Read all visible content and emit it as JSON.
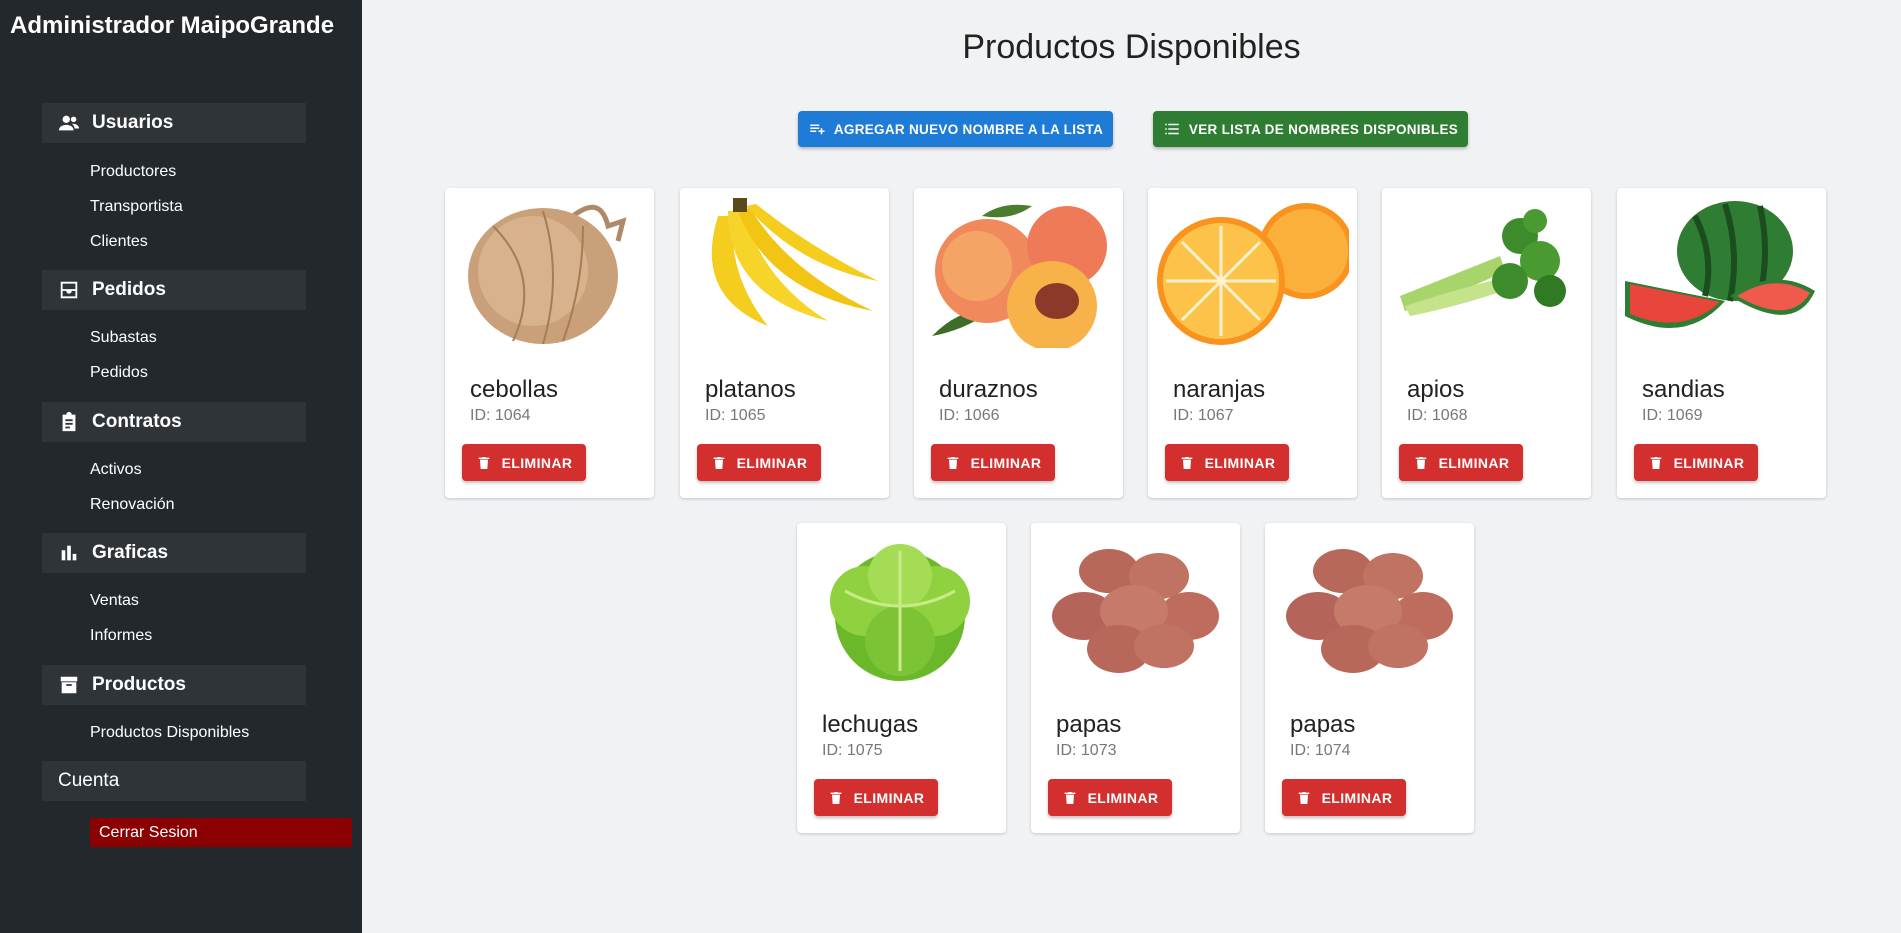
{
  "sidebar": {
    "brand": "Administrador MaipoGrande",
    "sections": [
      {
        "title": "Usuarios",
        "icon": "users-icon",
        "items": [
          "Productores",
          "Transportista",
          "Clientes"
        ]
      },
      {
        "title": "Pedidos",
        "icon": "inbox-icon",
        "items": [
          "Subastas",
          "Pedidos"
        ]
      },
      {
        "title": "Contratos",
        "icon": "clipboard-icon",
        "items": [
          "Activos",
          "Renovación"
        ]
      },
      {
        "title": "Graficas",
        "icon": "bar-chart-icon",
        "items": [
          "Ventas",
          "Informes"
        ]
      },
      {
        "title": "Productos",
        "icon": "archive-icon",
        "items": [
          "Productos Disponibles"
        ]
      }
    ],
    "account": {
      "title": "Cuenta",
      "logout": "Cerrar Sesion"
    }
  },
  "main": {
    "title": "Productos Disponibles",
    "add_button": "AGREGAR NUEVO NOMBRE A LA LISTA",
    "list_button": "VER LISTA DE NOMBRES DISPONIBLES",
    "delete_label": "ELIMINAR",
    "products": [
      {
        "name": "cebollas",
        "id": "ID: 1064",
        "image": "onion"
      },
      {
        "name": "platanos",
        "id": "ID: 1065",
        "image": "banana"
      },
      {
        "name": "duraznos",
        "id": "ID: 1066",
        "image": "peach"
      },
      {
        "name": "naranjas",
        "id": "ID: 1067",
        "image": "orange"
      },
      {
        "name": "apios",
        "id": "ID: 1068",
        "image": "celery"
      },
      {
        "name": "sandias",
        "id": "ID: 1069",
        "image": "watermelon"
      },
      {
        "name": "lechugas",
        "id": "ID: 1075",
        "image": "lettuce"
      },
      {
        "name": "papas",
        "id": "ID: 1073",
        "image": "potato"
      },
      {
        "name": "papas",
        "id": "ID: 1074",
        "image": "potato"
      }
    ]
  },
  "colors": {
    "sidebar_bg": "#22282c",
    "add_button": "#1e7bd6",
    "list_button": "#2e7d32",
    "delete_button": "#d32f2f",
    "logout_bg": "#8b0000"
  }
}
